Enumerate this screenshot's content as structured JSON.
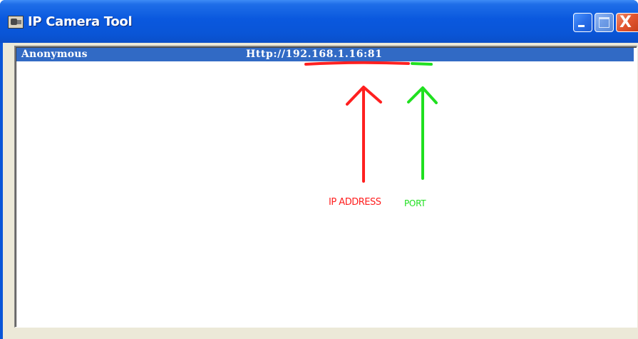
{
  "window": {
    "title": "IP Camera Tool",
    "close_glyph": "X"
  },
  "list": {
    "rows": [
      {
        "name": "Anonymous",
        "url": "Http://192.168.1.16:81"
      }
    ],
    "selected_row_color": "#316ac5"
  },
  "annotations": {
    "ip_label": "IP ADDRESS",
    "port_label": "PORT",
    "ip_color": "#ff2020",
    "port_color": "#20e020"
  },
  "icons": {
    "app": "ip-camera-app-icon",
    "minimize": "minimize-icon",
    "maximize": "maximize-icon",
    "close": "close-icon"
  }
}
